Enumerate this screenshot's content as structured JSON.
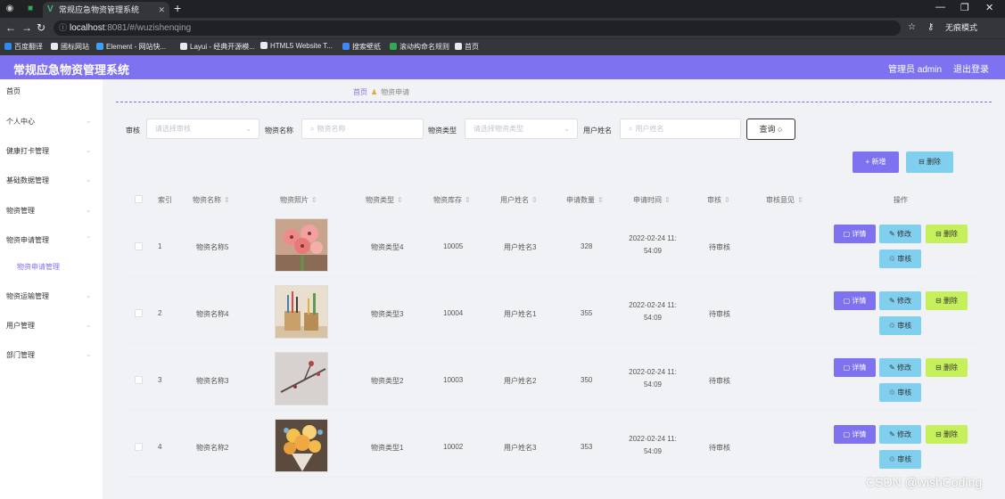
{
  "browser": {
    "tab_title": "常规应急物资管理系统",
    "new_tab": "+",
    "url_host": "localhost",
    "url_path": ":8081/#/wuzishenqing",
    "profile": "无痕模式",
    "bookmarks": [
      {
        "label": "百度翻译",
        "color": "#2d8cf0"
      },
      {
        "label": "國标网站",
        "color": "#e8eaed"
      },
      {
        "label": "Element - 网站快...",
        "color": "#409eff"
      },
      {
        "label": "Layui - 经典开源模...",
        "color": "#e8eaed"
      },
      {
        "label": "HTML5 Website T...",
        "color": "#e8eaed"
      },
      {
        "label": "搜索壁纸",
        "color": "#4285f4"
      },
      {
        "label": "滚动构命名规则",
        "color": "#34a853"
      },
      {
        "label": "首页",
        "color": "#e8eaed"
      }
    ]
  },
  "header": {
    "title": "常规应急物资管理系统",
    "admin": "管理员 admin",
    "logout": "退出登录"
  },
  "sidebar": {
    "items": [
      {
        "label": "首页"
      },
      {
        "label": "个人中心"
      },
      {
        "label": "健康打卡管理"
      },
      {
        "label": "基础数据管理"
      },
      {
        "label": "物资管理"
      },
      {
        "label": "物资申请管理"
      },
      {
        "label": "物资运输管理"
      },
      {
        "label": "用户管理"
      },
      {
        "label": "部门管理"
      }
    ],
    "active_sub": "物资申请管理"
  },
  "breadcrumb": {
    "home": "首页",
    "current": "物资申请"
  },
  "filters": {
    "audit_label": "审核",
    "audit_placeholder": "请选择审核",
    "name_label": "物资名称",
    "name_placeholder": "物资名称",
    "type_label": "物资类型",
    "type_placeholder": "请选择物资类型",
    "user_label": "用户姓名",
    "user_placeholder": "用户姓名",
    "query_label": "查询 ○"
  },
  "toolbar": {
    "add": "+ 新增",
    "delete": "⊟ 删除"
  },
  "table": {
    "headers": [
      "索引",
      "物资名称",
      "物资照片",
      "物资类型",
      "物资库存",
      "用户姓名",
      "申请数量",
      "申请时间",
      "审核",
      "审核意见",
      "操作"
    ],
    "actions": {
      "detail": "▢ 详情",
      "edit": "✎ 修改",
      "delete": "⊟ 删除",
      "audit": "♲ 审核"
    },
    "rows": [
      {
        "index": "1",
        "name": "物资名称5",
        "type": "物资类型4",
        "stock": "10005",
        "user": "用户姓名3",
        "qty": "328",
        "time1": "2022-02-24 11:",
        "time2": "54:09",
        "audit": "待审核",
        "photo": "flowers-photo"
      },
      {
        "index": "2",
        "name": "物资名称4",
        "type": "物资类型3",
        "stock": "10004",
        "user": "用户姓名1",
        "qty": "355",
        "time1": "2022-02-24 11:",
        "time2": "54:09",
        "audit": "待审核",
        "photo": "stationery-photo"
      },
      {
        "index": "3",
        "name": "物资名称3",
        "type": "物资类型2",
        "stock": "10003",
        "user": "用户姓名2",
        "qty": "350",
        "time1": "2022-02-24 11:",
        "time2": "54:09",
        "audit": "待审核",
        "photo": "branch-photo"
      },
      {
        "index": "4",
        "name": "物资名称2",
        "type": "物资类型1",
        "stock": "10002",
        "user": "用户姓名3",
        "qty": "353",
        "time1": "2022-02-24 11:",
        "time2": "54:09",
        "audit": "待审核",
        "photo": "bouquet-photo"
      }
    ]
  },
  "watermark": "CSDN @wishCoding",
  "colors": {
    "accent": "#7e72f0",
    "cyan": "#80cfef",
    "lime": "#c6ef5c"
  }
}
